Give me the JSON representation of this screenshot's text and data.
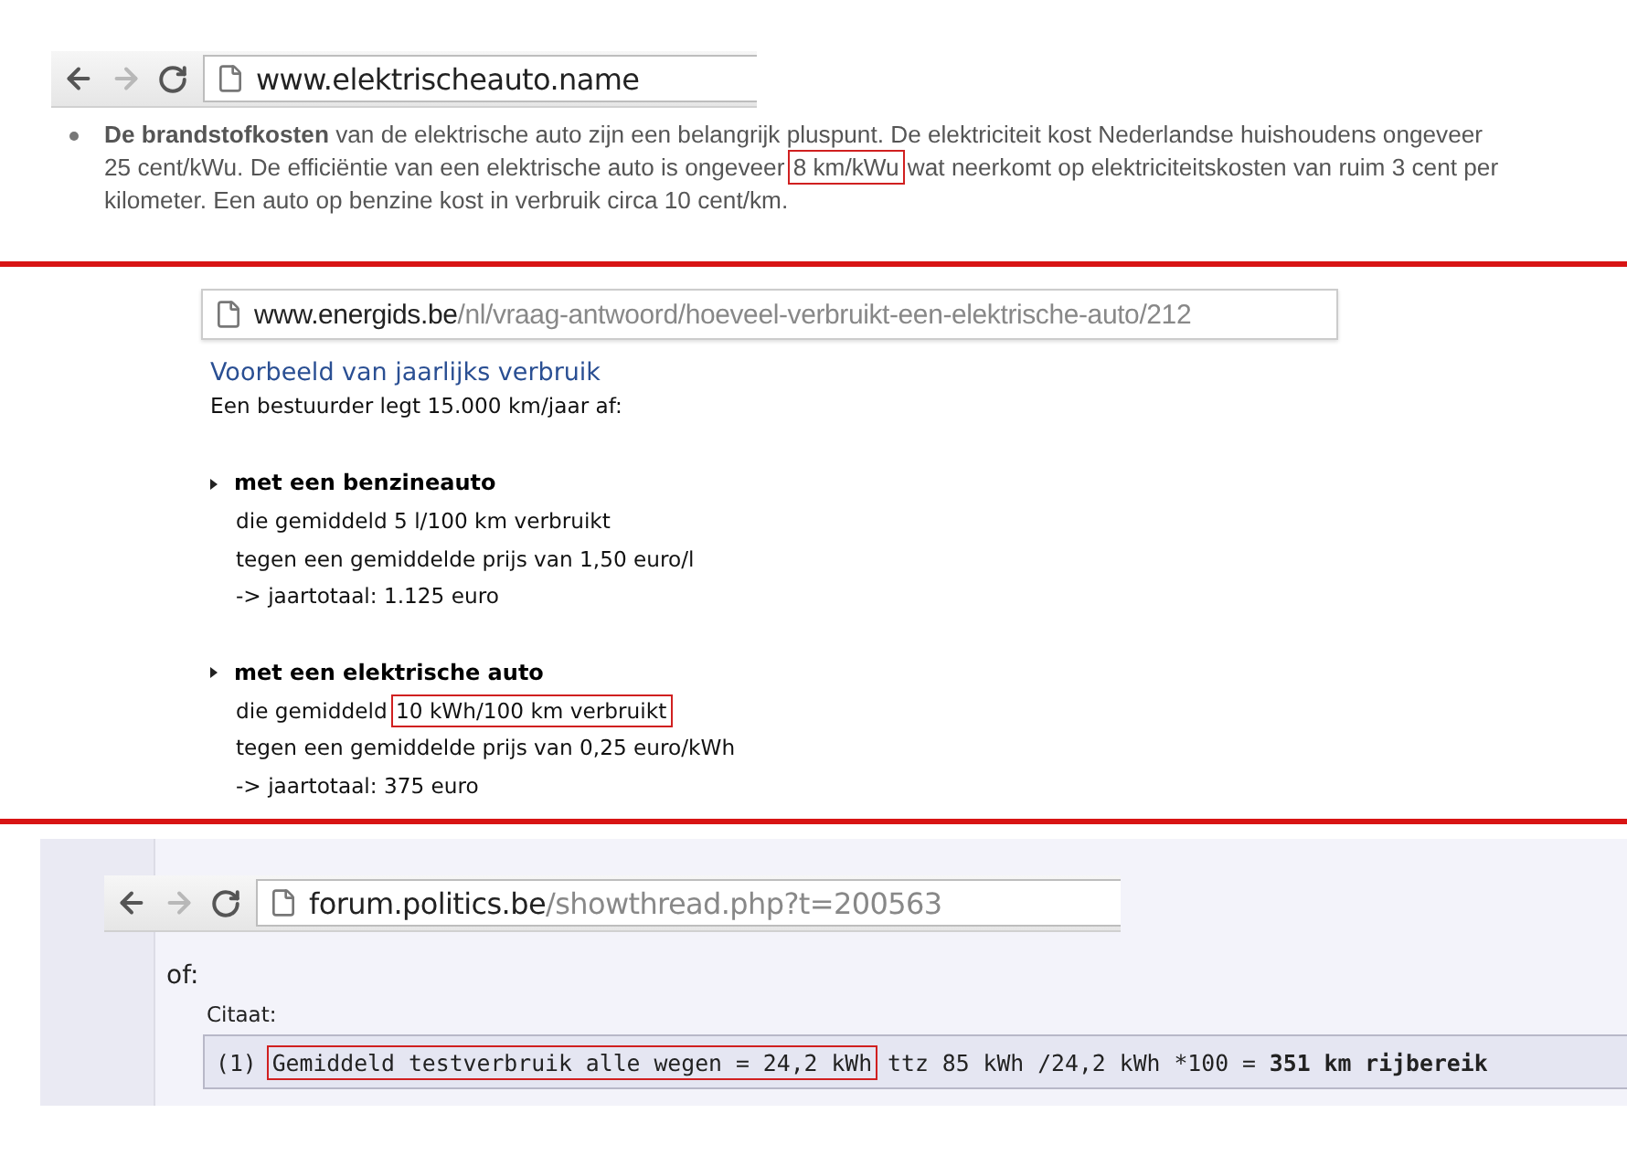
{
  "panels": [
    {
      "kind": "article",
      "url": {
        "host": "www.elektrischeauto.name"
      },
      "paragraph": [
        {
          "text": "De brandstofkosten",
          "bold": true,
          "boxed": false
        },
        {
          "text": " van de elektrische auto zijn een belangrijk pluspunt. De elektriciteit kost Nederlandse huishoudens ongeveer 25 cent/kWu. De efficiëntie van een elektrische auto is ongeveer ",
          "bold": false,
          "boxed": false
        },
        {
          "text": "8 km/kWu",
          "bold": false,
          "boxed": true
        },
        {
          "text": " wat neerkomt op elektriciteitskosten van ruim 3 cent per kilometer. Een auto op benzine kost in verbruik circa 10 cent/km.",
          "bold": false,
          "boxed": false
        }
      ]
    },
    {
      "kind": "faq",
      "url": {
        "host": "www.energids.be",
        "path": "/nl/vraag-antwoord/hoeveel-verbruikt-een-elektrische-auto/212"
      },
      "heading": "Voorbeeld van jaarlijks verbruik",
      "intro": "Een bestuurder legt 15.000 km/jaar af:",
      "items": [
        {
          "title": "met een benzineauto",
          "lines": [
            [
              {
                "text": "die gemiddeld 5 l/100 km verbruikt",
                "boxed": false
              }
            ],
            [
              {
                "text": "tegen een gemiddelde prijs van 1,50 euro/l",
                "boxed": false
              }
            ],
            [
              {
                "text": "-> jaartotaal: 1.125 euro",
                "boxed": false
              }
            ]
          ]
        },
        {
          "title": "met een elektrische auto",
          "lines": [
            [
              {
                "text": "die gemiddeld ",
                "boxed": false
              },
              {
                "text": "10 kWh/100 km verbruikt",
                "boxed": true
              }
            ],
            [
              {
                "text": "tegen een gemiddelde prijs van 0,25 euro/kWh",
                "boxed": false
              }
            ],
            [
              {
                "text": "-> jaartotaal: 375 euro",
                "boxed": false
              }
            ]
          ]
        }
      ]
    },
    {
      "kind": "forum",
      "url": {
        "host": "forum.politics.be",
        "path": "/showthread.php?t=200563"
      },
      "post_text": "of:",
      "quote_label": "Citaat:",
      "quote": [
        {
          "text": "(1) ",
          "bold": false,
          "boxed": false
        },
        {
          "text": "Gemiddeld testverbruik alle wegen = 24,2 kWh",
          "bold": false,
          "boxed": true
        },
        {
          "text": " ttz 85 kWh /24,2 kWh *100 = ",
          "bold": false,
          "boxed": false
        },
        {
          "text": "351 km rijbereik",
          "bold": true,
          "boxed": false
        }
      ]
    }
  ]
}
